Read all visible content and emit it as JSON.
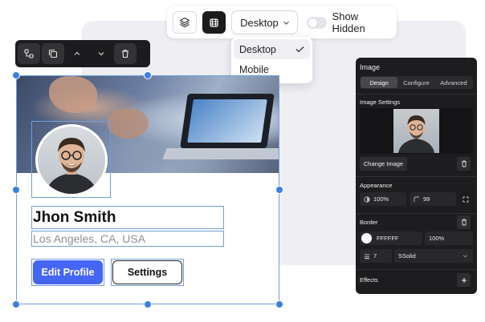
{
  "toolbar": {
    "device_selected": "Desktop",
    "show_hidden_label": "Show Hidden",
    "show_hidden_on": false
  },
  "device_dropdown": {
    "options": [
      "Desktop",
      "Mobile"
    ],
    "selected": "Desktop"
  },
  "element_toolbar": {
    "icons": [
      "hierarchy-icon",
      "duplicate-icon",
      "chevron-up-icon",
      "chevron-down-icon",
      "trash-icon"
    ]
  },
  "profile": {
    "name": "Jhon Smith",
    "location": "Los Angeles, CA, USA",
    "edit_button": "Edit Profile",
    "settings_button": "Settings"
  },
  "panel": {
    "title": "Image",
    "tabs": [
      "Design",
      "Configure",
      "Advanced"
    ],
    "active_tab": "Design",
    "image_settings_label": "Image Settings",
    "change_image_label": "Change Image",
    "appearance_label": "Appearance",
    "opacity": "100%",
    "radius": "99",
    "border_label": "Border",
    "border_color": "FFFFFF",
    "border_opacity": "100%",
    "border_width": "7",
    "border_style": "SSolid",
    "effects_label": "Effects"
  },
  "colors": {
    "accent": "#4565f5",
    "selection": "#3b7fe2",
    "panel_bg": "#1d1d1f"
  }
}
